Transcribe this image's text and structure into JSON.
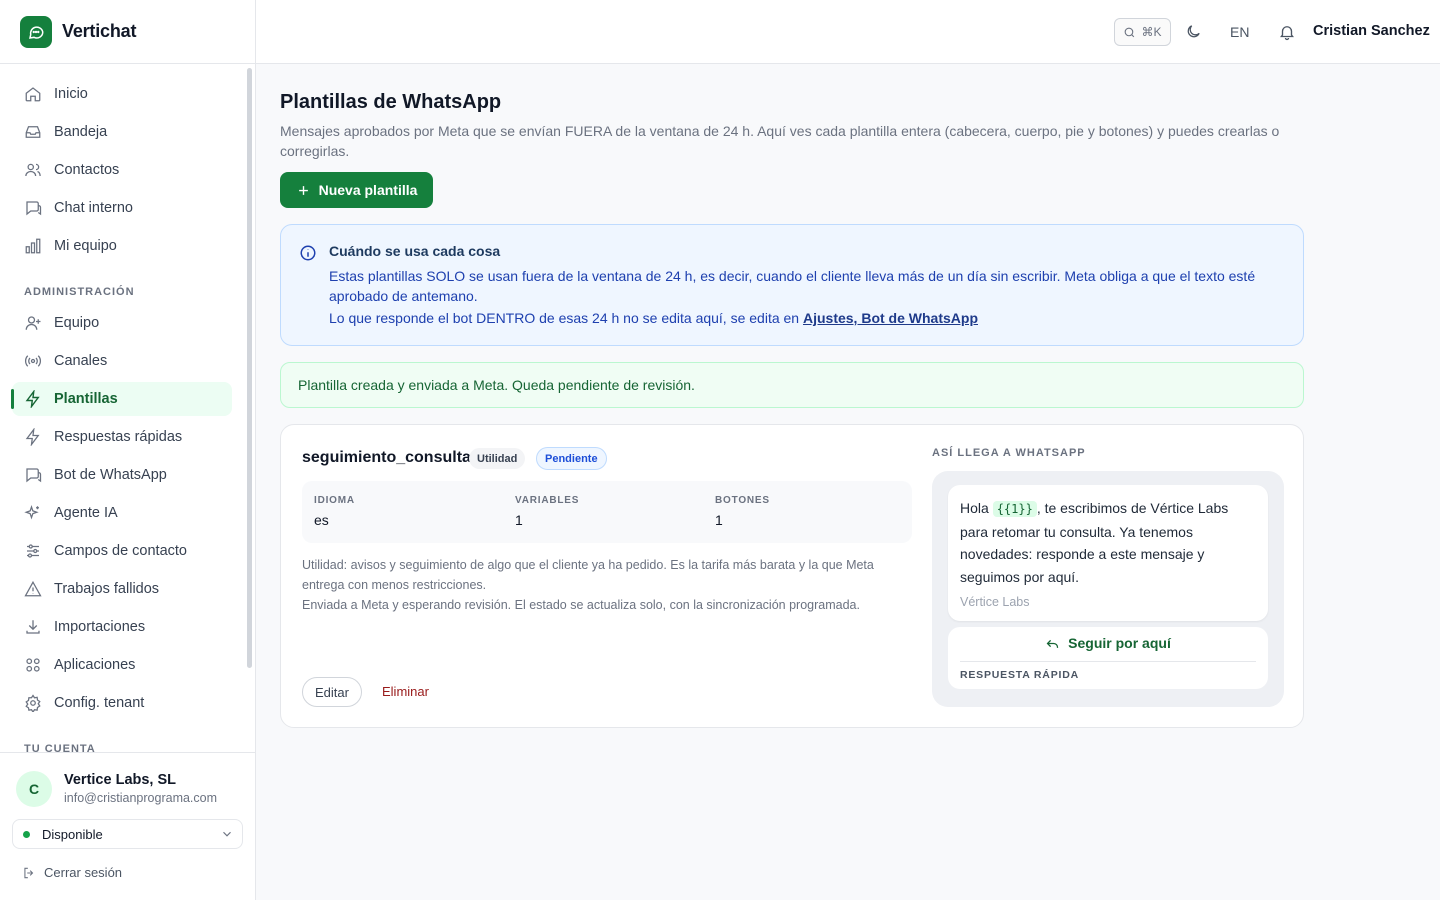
{
  "app": {
    "name": "Vertichat"
  },
  "sidebar": {
    "main": [
      {
        "label": "Inicio",
        "icon": "home-icon"
      },
      {
        "label": "Bandeja",
        "icon": "inbox-icon"
      },
      {
        "label": "Contactos",
        "icon": "users-icon"
      },
      {
        "label": "Chat interno",
        "icon": "chat-icon"
      },
      {
        "label": "Mi equipo",
        "icon": "bar-chart-icon"
      }
    ],
    "admin_heading": "ADMINISTRACIÓN",
    "admin": [
      {
        "label": "Equipo",
        "icon": "user-plus-icon"
      },
      {
        "label": "Canales",
        "icon": "broadcast-icon"
      },
      {
        "label": "Plantillas",
        "icon": "bolt-icon",
        "active": true
      },
      {
        "label": "Respuestas rápidas",
        "icon": "bolt-icon"
      },
      {
        "label": "Bot de WhatsApp",
        "icon": "chat-icon"
      },
      {
        "label": "Agente IA",
        "icon": "sparkles-icon"
      },
      {
        "label": "Campos de contacto",
        "icon": "sliders-icon"
      },
      {
        "label": "Trabajos fallidos",
        "icon": "warning-icon"
      },
      {
        "label": "Importaciones",
        "icon": "download-icon"
      },
      {
        "label": "Aplicaciones",
        "icon": "grid-icon"
      },
      {
        "label": "Config. tenant",
        "icon": "gear-icon"
      }
    ],
    "account_heading": "TU CUENTA",
    "account": {
      "initial": "C",
      "name": "Vertice Labs, SL",
      "email": "info@cristianprograma.com",
      "status": "Disponible",
      "logout": "Cerrar sesión"
    }
  },
  "topbar": {
    "shortcut": "⌘K",
    "language": "EN",
    "user": "Cristian Sanchez"
  },
  "page": {
    "title": "Plantillas de WhatsApp",
    "subtitle": "Mensajes aprobados por Meta que se envían FUERA de la ventana de 24 h. Aquí ves cada plantilla entera (cabecera, cuerpo, pie y botones) y puedes crearlas o corregirlas.",
    "new_button": "Nueva plantilla",
    "info": {
      "title": "Cuándo se usa cada cosa",
      "text": "Estas plantillas SOLO se usan fuera de la ventana de 24 h, es decir, cuando el cliente lleva más de un día sin escribir. Meta obliga a que el texto esté aprobado de antemano.",
      "line2_prefix": "Lo que responde el bot DENTRO de esas 24 h no se edita aquí, se edita en ",
      "line2_link": "Ajustes, Bot de WhatsApp"
    },
    "success": "Plantilla creada y enviada a Meta. Queda pendiente de revisión."
  },
  "template": {
    "name": "seguimiento_consulta",
    "category": "Utilidad",
    "status": "Pendiente",
    "meta": [
      {
        "label": "IDIOMA",
        "value": "es"
      },
      {
        "label": "VARIABLES",
        "value": "1"
      },
      {
        "label": "BOTONES",
        "value": "1"
      }
    ],
    "description": "Utilidad: avisos y seguimiento de algo que el cliente ya ha pedido. Es la tarifa más barata y la que Meta entrega con menos restricciones.",
    "state_note": "Enviada a Meta y esperando revisión. El estado se actualiza solo, con la sincronización programada.",
    "edit": "Editar",
    "delete": "Eliminar",
    "preview": {
      "heading": "ASÍ LLEGA A WHATSAPP",
      "body_prefix": "Hola ",
      "variable": "{{1}}",
      "body_suffix": ", te escribimos de Vértice Labs para retomar tu consulta. Ya tenemos novedades: responde a este mensaje y seguimos por aquí.",
      "footer": "Vértice Labs",
      "button": "Seguir por aquí",
      "button_type": "RESPUESTA RÁPIDA"
    }
  },
  "colors": {
    "brand": "#15803d",
    "info_bg": "#eff6ff",
    "success_bg": "#f0fdf4"
  }
}
